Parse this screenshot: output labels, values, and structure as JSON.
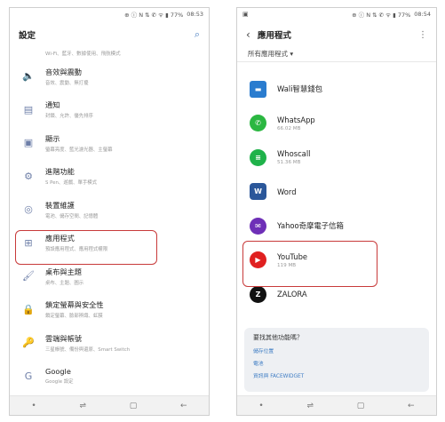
{
  "left_phone": {
    "status": {
      "indicators": "⊕ ⓘ N ⇅ ✆ ᯤ ▮ 77%",
      "time": "08:53"
    },
    "title": "設定",
    "cut_subtitle": "Wi-Fi、藍牙、數據使用、飛航模式",
    "items": [
      {
        "label": "音效與震動",
        "subtitle": "音效、震動、無打擾",
        "icon": "speaker-icon",
        "glyph": "🔈"
      },
      {
        "label": "通知",
        "subtitle": "封鎖、允許、優先排序",
        "icon": "notification-icon",
        "glyph": "▤"
      },
      {
        "label": "顯示",
        "subtitle": "螢幕亮度、藍光濾光器、主螢幕",
        "icon": "display-icon",
        "glyph": "▣"
      },
      {
        "label": "進階功能",
        "subtitle": "S Pen、遊戲、單手模式",
        "icon": "advanced-features-icon",
        "glyph": "⚙"
      },
      {
        "label": "裝置維護",
        "subtitle": "電池、儲存空間、記憶體",
        "icon": "device-maintenance-icon",
        "glyph": "◎"
      },
      {
        "label": "應用程式",
        "subtitle": "預設應用程式、應用程式權限",
        "icon": "apps-icon",
        "glyph": "⊞"
      },
      {
        "label": "桌布與主題",
        "subtitle": "桌布、主題、圖示",
        "icon": "wallpaper-icon",
        "glyph": "🖌"
      },
      {
        "label": "鎖定螢幕與安全性",
        "subtitle": "鎖定螢幕、臉部辨識、虹膜",
        "icon": "lock-icon",
        "glyph": "🔒"
      },
      {
        "label": "雲端與帳號",
        "subtitle": "三星帳號、備份與還原、Smart Switch",
        "icon": "key-icon",
        "glyph": "🔑"
      },
      {
        "label": "Google",
        "subtitle": "Google 設定",
        "icon": "google-icon",
        "glyph": "G"
      }
    ],
    "nav": [
      "•",
      "⇌",
      "▢",
      "←"
    ]
  },
  "right_phone": {
    "status": {
      "indicators": "⊕ ⓘ N ⇅ ✆ ᯤ ▮ 77%",
      "time": "08:54",
      "left_glyph": "▣"
    },
    "title": "應用程式",
    "filter": "所有應用程式 ▾",
    "apps": [
      {
        "name": "Wali智慧錢包",
        "size": "",
        "color": "#2a7ccf",
        "glyph": "▬"
      },
      {
        "name": "WhatsApp",
        "size": "66.02 MB",
        "color": "#2bb741",
        "glyph": "✆"
      },
      {
        "name": "Whoscall",
        "size": "51.36 MB",
        "color": "#1fb24a",
        "glyph": "≡"
      },
      {
        "name": "Word",
        "size": "",
        "color": "#2b579a",
        "glyph": "W"
      },
      {
        "name": "Yahoo奇摩電子信箱",
        "size": "",
        "color": "#6e2fb7",
        "glyph": "✉"
      },
      {
        "name": "YouTube",
        "size": "119 MB",
        "color": "#e02020",
        "glyph": "▶"
      },
      {
        "name": "ZALORA",
        "size": "",
        "color": "#111111",
        "glyph": "Z"
      }
    ],
    "help": {
      "title": "要找其他功能嗎？",
      "links": [
        "儲存位置",
        "電池",
        "資訊與 FACEWIDGET"
      ]
    },
    "nav": [
      "•",
      "⇌",
      "▢",
      "←"
    ]
  }
}
